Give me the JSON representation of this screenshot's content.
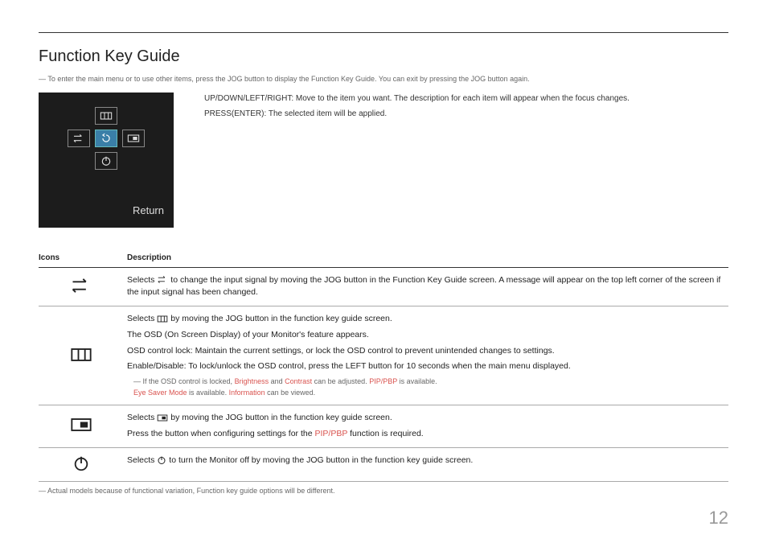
{
  "title": "Function Key Guide",
  "intro_note": "To enter the main menu or to use other items, press the JOG button to display the Function Key Guide. You can exit by pressing the JOG button again.",
  "side_desc": {
    "line1": "UP/DOWN/LEFT/RIGHT: Move to the item you want. The description for each item will appear when the focus changes.",
    "line2": "PRESS(ENTER): The selected item will be applied."
  },
  "jog": {
    "return_label": "Return"
  },
  "table": {
    "col_icons": "Icons",
    "col_desc": "Description",
    "row1": {
      "p1a": "Selects ",
      "p1b": " to change the input signal by moving the JOG button in the Function Key Guide screen. A message will appear on the top left corner of the screen if the input signal has been changed."
    },
    "row2": {
      "p1a": "Selects ",
      "p1b": " by moving the JOG button in the function key guide screen.",
      "p2": "The OSD (On Screen Display) of your Monitor's feature appears.",
      "p3": "OSD control lock: Maintain the current settings, or lock the OSD control to prevent unintended changes to settings.",
      "p4": "Enable/Disable: To lock/unlock the OSD control, press the LEFT button for 10 seconds when the main menu displayed.",
      "note_a": "If the OSD control is locked, ",
      "note_brightness": "Brightness",
      "note_and": " and ",
      "note_contrast": "Contrast",
      "note_b": " can be adjusted. ",
      "note_pip1": "PIP/PBP",
      "note_c": " is available.",
      "note2a": "Eye Saver Mode",
      "note2b": " is available. ",
      "note2c": "Information",
      "note2d": " can be viewed."
    },
    "row3": {
      "p1a": "Selects ",
      "p1b": " by moving the JOG button in the function key guide screen.",
      "p2a": "Press the button when configuring settings for the ",
      "p2_pip": "PIP/PBP",
      "p2b": " function is required."
    },
    "row4": {
      "p1a": "Selects ",
      "p1b": " to turn the Monitor off by moving the JOG button in the function key guide screen."
    }
  },
  "footnote": "Actual models because of functional variation, Function key guide options will be different.",
  "page_number": "12"
}
